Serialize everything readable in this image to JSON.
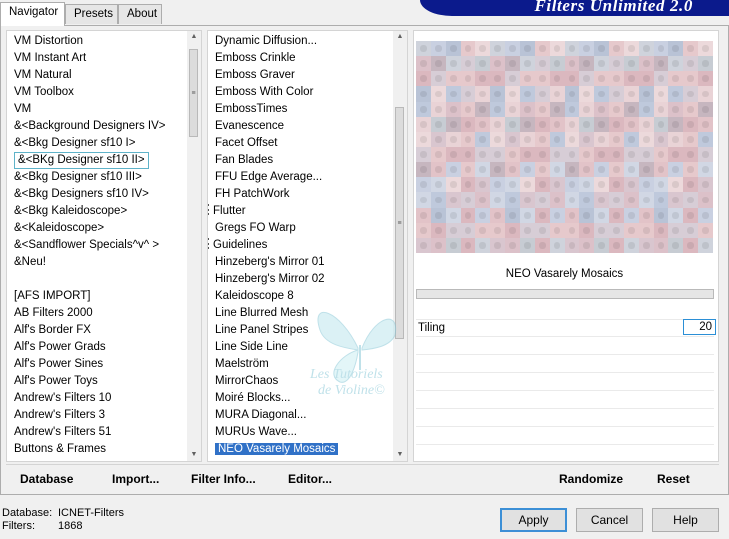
{
  "tabs": [
    "Navigator",
    "Presets",
    "About"
  ],
  "banner_title": "Filters Unlimited 2.0",
  "categories": [
    "VM Distortion",
    "VM Instant Art",
    "VM Natural",
    "VM Toolbox",
    "VM",
    "&<Background Designers IV>",
    "&<Bkg Designer sf10 I>",
    "&<BKg Designer sf10 II>",
    "&<Bkg Designer sf10 III>",
    "&<Bkg Designers sf10 IV>",
    "&<Bkg Kaleidoscope>",
    "&<Kaleidoscope>",
    "&<Sandflower Specials^v^ >",
    "&Neu!",
    "",
    "[AFS IMPORT]",
    "AB Filters 2000",
    "Alf's Border FX",
    "Alf's Power Grads",
    "Alf's Power Sines",
    "Alf's Power Toys",
    "Andrew's Filters 10",
    "Andrew's Filters 3",
    "Andrew's Filters 51",
    "Buttons & Frames"
  ],
  "selected_category_index": 7,
  "filters": [
    {
      "label": "Dynamic Diffusion...",
      "mark": false
    },
    {
      "label": "Emboss Crinkle",
      "mark": false
    },
    {
      "label": "Emboss Graver",
      "mark": false
    },
    {
      "label": "Emboss With Color",
      "mark": false
    },
    {
      "label": "EmbossTimes",
      "mark": false
    },
    {
      "label": "Evanescence",
      "mark": false
    },
    {
      "label": "Facet Offset",
      "mark": false
    },
    {
      "label": "Fan Blades",
      "mark": false
    },
    {
      "label": "FFU Edge Average...",
      "mark": false
    },
    {
      "label": "FH PatchWork",
      "mark": false
    },
    {
      "label": "Flutter",
      "mark": true
    },
    {
      "label": "Gregs FO Warp",
      "mark": false
    },
    {
      "label": "Guidelines",
      "mark": true
    },
    {
      "label": "Hinzeberg's Mirror 01",
      "mark": false
    },
    {
      "label": "Hinzeberg's Mirror 02",
      "mark": false
    },
    {
      "label": "Kaleidoscope 8",
      "mark": false
    },
    {
      "label": "Line Blurred Mesh",
      "mark": false
    },
    {
      "label": "Line Panel Stripes",
      "mark": false
    },
    {
      "label": "Line Side Line",
      "mark": false
    },
    {
      "label": "Maelström",
      "mark": false
    },
    {
      "label": "MirrorChaos",
      "mark": false
    },
    {
      "label": "Moiré Blocks...",
      "mark": false
    },
    {
      "label": "MURA Diagonal...",
      "mark": false
    },
    {
      "label": "MURUs Wave...",
      "mark": false
    },
    {
      "label": "NEO Vasarely Mosaics",
      "mark": false
    }
  ],
  "selected_filter_index": 24,
  "preview_name": "NEO Vasarely Mosaics",
  "param": {
    "label": "Tiling",
    "value": "20"
  },
  "bottom_links": {
    "database": "Database",
    "import": "Import...",
    "filter_info": "Filter Info...",
    "editor": "Editor..."
  },
  "preview_actions": {
    "randomize": "Randomize",
    "reset": "Reset"
  },
  "status": {
    "database_label": "Database:",
    "database_value": "ICNET-Filters",
    "filters_label": "Filters:",
    "filters_value": "1868"
  },
  "buttons": {
    "apply": "Apply",
    "cancel": "Cancel",
    "help": "Help"
  },
  "watermark": {
    "line1": "Les Tutoriels",
    "line2": "de Violine©"
  },
  "colors": {
    "banner": "#0b1a8c",
    "selection": "#3071c7",
    "selected_outline": "#5fb3c9",
    "apply_focus": "#3c8fd6"
  }
}
